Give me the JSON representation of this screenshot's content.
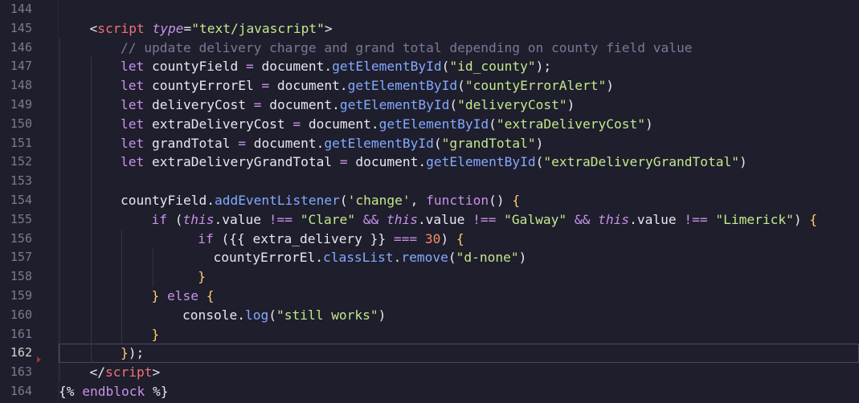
{
  "editor": {
    "active_line": 162,
    "lines": [
      {
        "n": "144",
        "indent": 0,
        "tokens": []
      },
      {
        "n": "145",
        "indent": 1,
        "tokens": [
          {
            "t": "<",
            "c": "punct"
          },
          {
            "t": "script",
            "c": "tag"
          },
          {
            "t": " ",
            "c": "plain"
          },
          {
            "t": "type",
            "c": "attr"
          },
          {
            "t": "=",
            "c": "punct"
          },
          {
            "t": "\"text/javascript\"",
            "c": "str"
          },
          {
            "t": ">",
            "c": "punct"
          }
        ]
      },
      {
        "n": "146",
        "indent": 2,
        "tokens": [
          {
            "t": "// update delivery charge and grand total depending on county field value",
            "c": "comment"
          }
        ]
      },
      {
        "n": "147",
        "indent": 2,
        "tokens": [
          {
            "t": "let",
            "c": "kw"
          },
          {
            "t": " countyField ",
            "c": "plain"
          },
          {
            "t": "=",
            "c": "op"
          },
          {
            "t": " document.",
            "c": "plain"
          },
          {
            "t": "getElementById",
            "c": "fn"
          },
          {
            "t": "(",
            "c": "punct"
          },
          {
            "t": "\"id_county\"",
            "c": "str"
          },
          {
            "t": ");",
            "c": "punct"
          }
        ]
      },
      {
        "n": "148",
        "indent": 2,
        "tokens": [
          {
            "t": "let",
            "c": "kw"
          },
          {
            "t": " countyErrorEl ",
            "c": "plain"
          },
          {
            "t": "=",
            "c": "op"
          },
          {
            "t": " document.",
            "c": "plain"
          },
          {
            "t": "getElementById",
            "c": "fn"
          },
          {
            "t": "(",
            "c": "punct"
          },
          {
            "t": "\"countyErrorAlert\"",
            "c": "str"
          },
          {
            "t": ")",
            "c": "punct"
          }
        ]
      },
      {
        "n": "149",
        "indent": 2,
        "tokens": [
          {
            "t": "let",
            "c": "kw"
          },
          {
            "t": " deliveryCost ",
            "c": "plain"
          },
          {
            "t": "=",
            "c": "op"
          },
          {
            "t": " document.",
            "c": "plain"
          },
          {
            "t": "getElementById",
            "c": "fn"
          },
          {
            "t": "(",
            "c": "punct"
          },
          {
            "t": "\"deliveryCost\"",
            "c": "str"
          },
          {
            "t": ")",
            "c": "punct"
          }
        ]
      },
      {
        "n": "150",
        "indent": 2,
        "tokens": [
          {
            "t": "let",
            "c": "kw"
          },
          {
            "t": " extraDeliveryCost ",
            "c": "plain"
          },
          {
            "t": "=",
            "c": "op"
          },
          {
            "t": " document.",
            "c": "plain"
          },
          {
            "t": "getElementById",
            "c": "fn"
          },
          {
            "t": "(",
            "c": "punct"
          },
          {
            "t": "\"extraDeliveryCost\"",
            "c": "str"
          },
          {
            "t": ")",
            "c": "punct"
          }
        ]
      },
      {
        "n": "151",
        "indent": 2,
        "tokens": [
          {
            "t": "let",
            "c": "kw"
          },
          {
            "t": " grandTotal ",
            "c": "plain"
          },
          {
            "t": "=",
            "c": "op"
          },
          {
            "t": " document.",
            "c": "plain"
          },
          {
            "t": "getElementById",
            "c": "fn"
          },
          {
            "t": "(",
            "c": "punct"
          },
          {
            "t": "\"grandTotal\"",
            "c": "str"
          },
          {
            "t": ")",
            "c": "punct"
          }
        ]
      },
      {
        "n": "152",
        "indent": 2,
        "tokens": [
          {
            "t": "let",
            "c": "kw"
          },
          {
            "t": " extraDeliveryGrandTotal ",
            "c": "plain"
          },
          {
            "t": "=",
            "c": "op"
          },
          {
            "t": " document.",
            "c": "plain"
          },
          {
            "t": "getElementById",
            "c": "fn"
          },
          {
            "t": "(",
            "c": "punct"
          },
          {
            "t": "\"extraDeliveryGrandTotal\"",
            "c": "str"
          },
          {
            "t": ")",
            "c": "punct"
          }
        ]
      },
      {
        "n": "153",
        "indent": 0,
        "tokens": []
      },
      {
        "n": "154",
        "indent": 2,
        "tokens": [
          {
            "t": "countyField.",
            "c": "plain"
          },
          {
            "t": "addEventListener",
            "c": "fn"
          },
          {
            "t": "(",
            "c": "punct"
          },
          {
            "t": "'change'",
            "c": "str"
          },
          {
            "t": ", ",
            "c": "punct"
          },
          {
            "t": "function",
            "c": "kw"
          },
          {
            "t": "() ",
            "c": "punct"
          },
          {
            "t": "{",
            "c": "brace"
          }
        ]
      },
      {
        "n": "155",
        "indent": 3,
        "tokens": [
          {
            "t": "if",
            "c": "kw"
          },
          {
            "t": " (",
            "c": "punct"
          },
          {
            "t": "this",
            "c": "this"
          },
          {
            "t": ".value ",
            "c": "plain"
          },
          {
            "t": "!==",
            "c": "op"
          },
          {
            "t": " ",
            "c": "plain"
          },
          {
            "t": "\"Clare\"",
            "c": "str"
          },
          {
            "t": " ",
            "c": "plain"
          },
          {
            "t": "&&",
            "c": "op"
          },
          {
            "t": " ",
            "c": "plain"
          },
          {
            "t": "this",
            "c": "this"
          },
          {
            "t": ".value ",
            "c": "plain"
          },
          {
            "t": "!==",
            "c": "op"
          },
          {
            "t": " ",
            "c": "plain"
          },
          {
            "t": "\"Galway\"",
            "c": "str"
          },
          {
            "t": " ",
            "c": "plain"
          },
          {
            "t": "&&",
            "c": "op"
          },
          {
            "t": " ",
            "c": "plain"
          },
          {
            "t": "this",
            "c": "this"
          },
          {
            "t": ".value ",
            "c": "plain"
          },
          {
            "t": "!==",
            "c": "op"
          },
          {
            "t": " ",
            "c": "plain"
          },
          {
            "t": "\"Limerick\"",
            "c": "str"
          },
          {
            "t": ") ",
            "c": "punct"
          },
          {
            "t": "{",
            "c": "brace"
          }
        ]
      },
      {
        "n": "156",
        "indent": 4.5,
        "tokens": [
          {
            "t": "if",
            "c": "kw"
          },
          {
            "t": " (",
            "c": "punct"
          },
          {
            "t": "{{ extra_delivery }}",
            "c": "plain"
          },
          {
            "t": " ",
            "c": "plain"
          },
          {
            "t": "===",
            "c": "op"
          },
          {
            "t": " ",
            "c": "plain"
          },
          {
            "t": "30",
            "c": "num"
          },
          {
            "t": ") ",
            "c": "punct"
          },
          {
            "t": "{",
            "c": "brace"
          }
        ]
      },
      {
        "n": "157",
        "indent": 5,
        "tokens": [
          {
            "t": "countyErrorEl.",
            "c": "plain"
          },
          {
            "t": "classList",
            "c": "fn"
          },
          {
            "t": ".",
            "c": "plain"
          },
          {
            "t": "remove",
            "c": "fn"
          },
          {
            "t": "(",
            "c": "punct"
          },
          {
            "t": "\"d-none\"",
            "c": "str"
          },
          {
            "t": ")",
            "c": "punct"
          }
        ]
      },
      {
        "n": "158",
        "indent": 4.5,
        "tokens": [
          {
            "t": "}",
            "c": "brace"
          }
        ]
      },
      {
        "n": "159",
        "indent": 3,
        "tokens": [
          {
            "t": "}",
            "c": "brace"
          },
          {
            "t": " ",
            "c": "plain"
          },
          {
            "t": "else",
            "c": "kw"
          },
          {
            "t": " ",
            "c": "plain"
          },
          {
            "t": "{",
            "c": "brace"
          }
        ]
      },
      {
        "n": "160",
        "indent": 4,
        "tokens": [
          {
            "t": "console.",
            "c": "plain"
          },
          {
            "t": "log",
            "c": "fn"
          },
          {
            "t": "(",
            "c": "punct"
          },
          {
            "t": "\"still works\"",
            "c": "str"
          },
          {
            "t": ")",
            "c": "punct"
          }
        ]
      },
      {
        "n": "161",
        "indent": 3,
        "tokens": [
          {
            "t": "}",
            "c": "brace"
          }
        ]
      },
      {
        "n": "162",
        "indent": 2,
        "tokens": [
          {
            "t": "}",
            "c": "brace"
          },
          {
            "t": ");",
            "c": "punct"
          }
        ]
      },
      {
        "n": "163",
        "indent": 1,
        "tokens": [
          {
            "t": "</",
            "c": "punct"
          },
          {
            "t": "script",
            "c": "tag"
          },
          {
            "t": ">",
            "c": "punct"
          }
        ]
      },
      {
        "n": "164",
        "indent": 0,
        "tokens": [
          {
            "t": "{% ",
            "c": "plain"
          },
          {
            "t": "endblock",
            "c": "kw"
          },
          {
            "t": " %}",
            "c": "plain"
          }
        ]
      }
    ]
  },
  "colors": {
    "background": "#1f1e2c",
    "tag": "#f07178",
    "string": "#c3e88d",
    "keyword": "#c792ea",
    "function": "#82aaff",
    "comment": "#7a7896",
    "number": "#f78c6c",
    "brace": "#ffcb6b"
  },
  "icons": {
    "fold_marker": "fold-arrow-icon"
  }
}
